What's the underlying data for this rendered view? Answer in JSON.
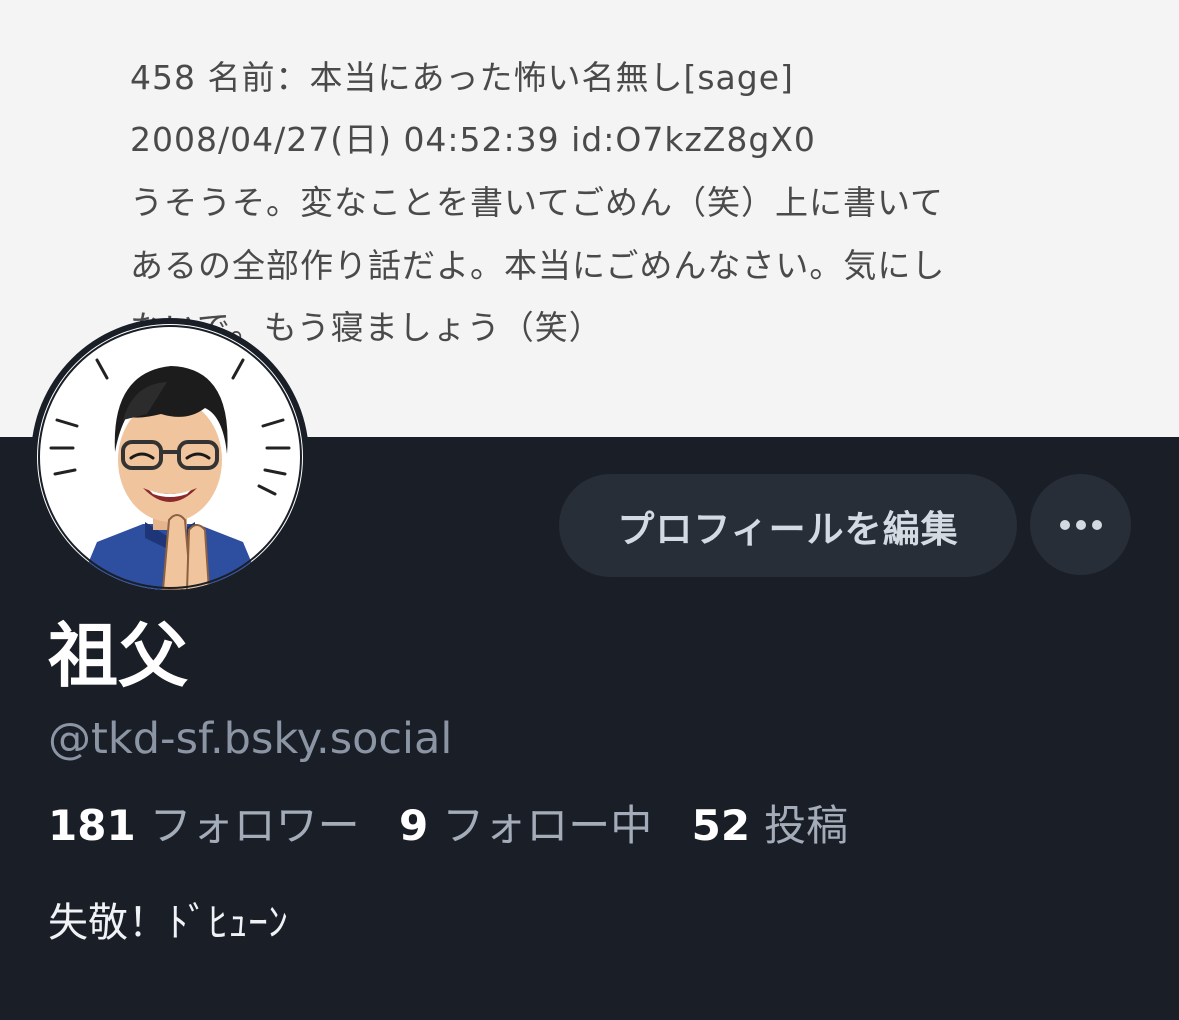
{
  "banner": {
    "lines": [
      "458 名前：本当にあった怖い名無し[sage]",
      "2008/04/27(日) 04:52:39 id:O7kzZ8gX0",
      "うそうそ。変なことを書いてごめん（笑）上に書いて",
      "あるの全部作り話だよ。本当にごめんなさい。気にし",
      "ないで。もう寝ましょう（笑）"
    ]
  },
  "profile": {
    "display_name": "祖父",
    "handle": "@tkd-sf.bsky.social",
    "edit_button_label": "プロフィールを編集",
    "more_button_label": "⋯",
    "stats": [
      {
        "count": "181",
        "label": "フォロワー"
      },
      {
        "count": "9",
        "label": "フォロー中"
      },
      {
        "count": "52",
        "label": "投稿"
      }
    ],
    "bio": "失敬！ﾄﾞﾋｭｰﾝ"
  },
  "icons": {
    "avatar": "cartoon-man-with-glasses-avatar",
    "more": "ellipsis-icon"
  },
  "colors": {
    "background": "#1a1f27",
    "button_bg": "#272e38",
    "banner_bg": "#f4f4f4"
  }
}
